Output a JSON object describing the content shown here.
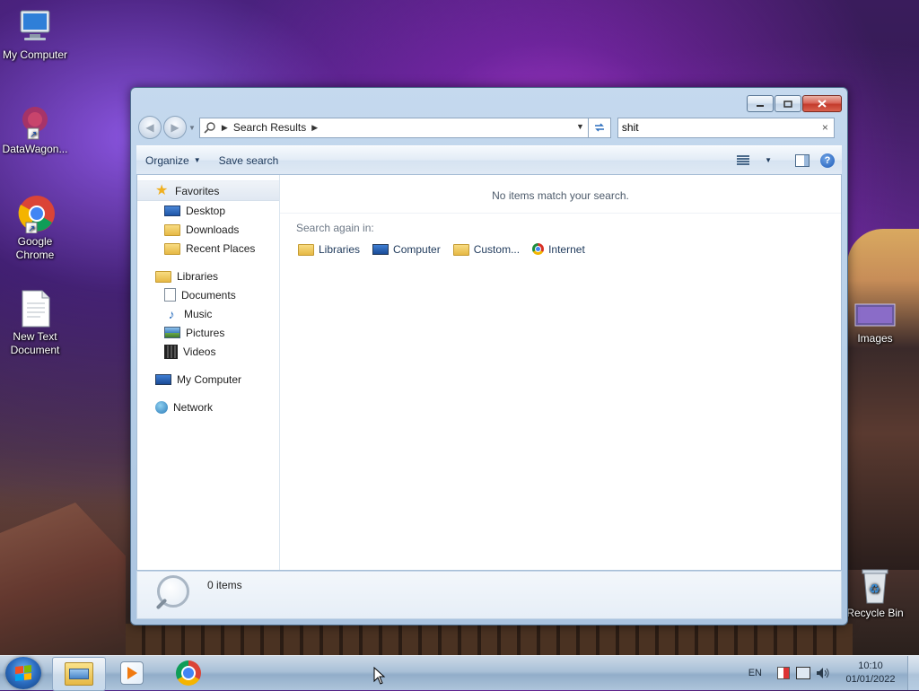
{
  "desktop": {
    "icons": [
      {
        "label": "My Computer",
        "icon": "computer-icon"
      },
      {
        "label": "DataWagon...",
        "icon": "datawagon-icon"
      },
      {
        "label": "Google Chrome",
        "icon": "chrome-icon"
      },
      {
        "label": "New Text Document",
        "icon": "text-document-icon"
      },
      {
        "label": "Images",
        "icon": "images-folder-icon"
      },
      {
        "label": "Recycle Bin",
        "icon": "recycle-bin-icon"
      }
    ]
  },
  "window": {
    "address": {
      "breadcrumb": "Search Results",
      "icon": "search-icon"
    },
    "search": {
      "value": "shit",
      "clear_label": "×"
    },
    "toolbar": {
      "organize_label": "Organize",
      "save_search_label": "Save search",
      "help_label": "?"
    },
    "navpane": {
      "favorites": "Favorites",
      "favorites_items": [
        "Desktop",
        "Downloads",
        "Recent Places"
      ],
      "libraries": "Libraries",
      "libraries_items": [
        "Documents",
        "Music",
        "Pictures",
        "Videos"
      ],
      "computer": "My Computer",
      "network": "Network"
    },
    "main": {
      "empty_message": "No items match your search.",
      "search_again_label": "Search again in:",
      "search_again_items": [
        "Libraries",
        "Computer",
        "Custom...",
        "Internet"
      ]
    },
    "details": {
      "items_count": "0 items"
    }
  },
  "taskbar": {
    "language": "EN",
    "time": "10:10",
    "date": "01/01/2022"
  }
}
